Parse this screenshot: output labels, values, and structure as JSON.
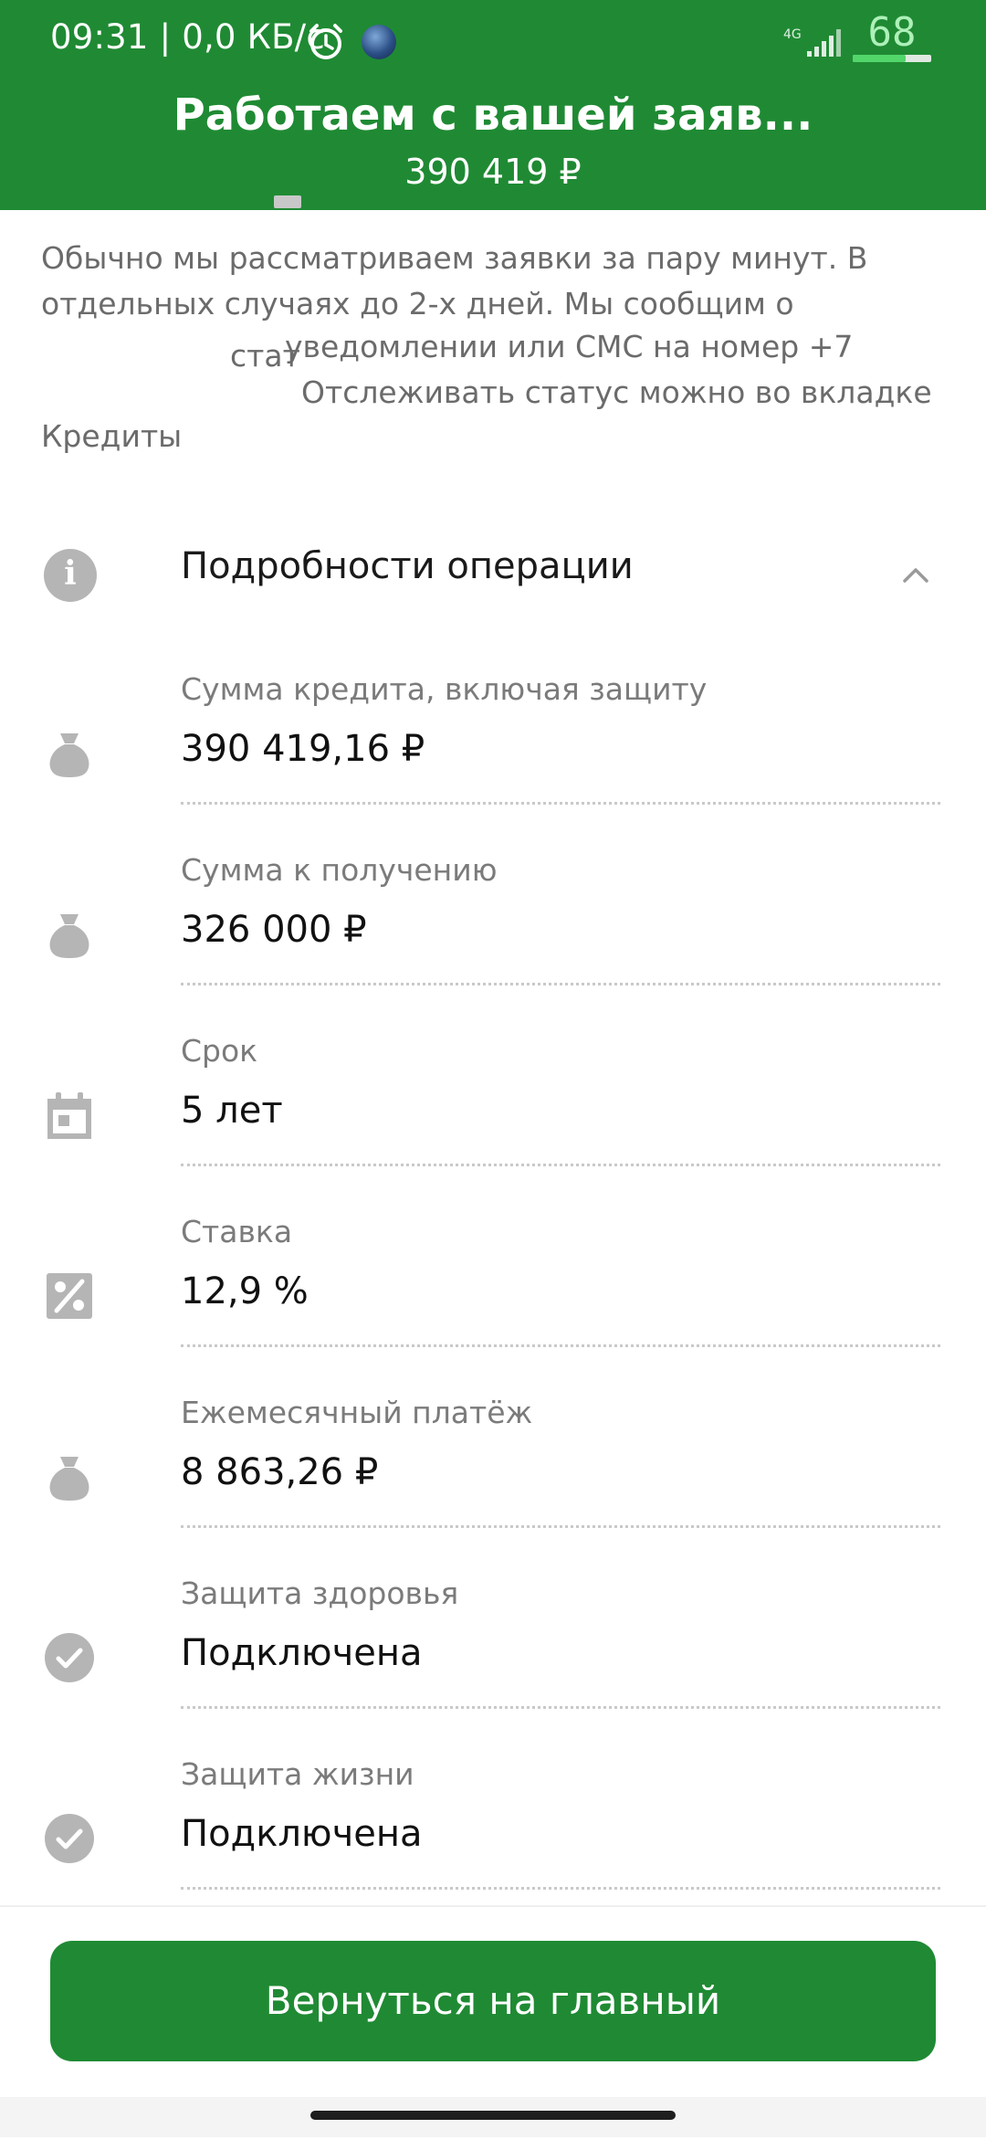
{
  "status_bar": {
    "time_speed": "09:31 | 0,0 КБ/с",
    "network": "4G",
    "battery": "68",
    "battery_level_percent": 68,
    "icons": [
      "alarm-icon",
      "app-icon",
      "signal-icon",
      "battery-icon"
    ]
  },
  "header": {
    "title": "Работаем с вашей заяв...",
    "amount": "390 419 ₽"
  },
  "intro": {
    "line1": "Обычно мы рассматриваем заявки за пару минут. В",
    "line2": "отдельных случаях до 2-х дней. Мы сообщим о",
    "fragment_a": "стат",
    "fragment_b": "уведомлении или СМС на номер +7",
    "fragment_c": "Отслеживать статус можно во вкладке",
    "credits": "Кредиты"
  },
  "details": {
    "title": "Подробности операции",
    "rows": [
      {
        "label": "Сумма кредита, включая защиту",
        "value": "390 419,16 ₽",
        "icon": "money-bag-icon"
      },
      {
        "label": "Сумма к получению",
        "value": "326 000 ₽",
        "icon": "money-bag-icon"
      },
      {
        "label": "Срок",
        "value": "5 лет",
        "icon": "calendar-icon"
      },
      {
        "label": "Ставка",
        "value": "12,9 %",
        "icon": "percent-icon"
      },
      {
        "label": "Ежемесячный платёж",
        "value": "8 863,26 ₽",
        "icon": "money-bag-icon"
      },
      {
        "label": "Защита здоровья",
        "value": "Подключена",
        "icon": "check-circle-icon"
      },
      {
        "label": "Защита жизни",
        "value": "Подключена",
        "icon": "check-circle-icon"
      }
    ]
  },
  "button": {
    "label": "Вернуться на главный"
  },
  "colors": {
    "brand_green": "#1f8a33",
    "icon_gray": "#b5b5b5"
  }
}
